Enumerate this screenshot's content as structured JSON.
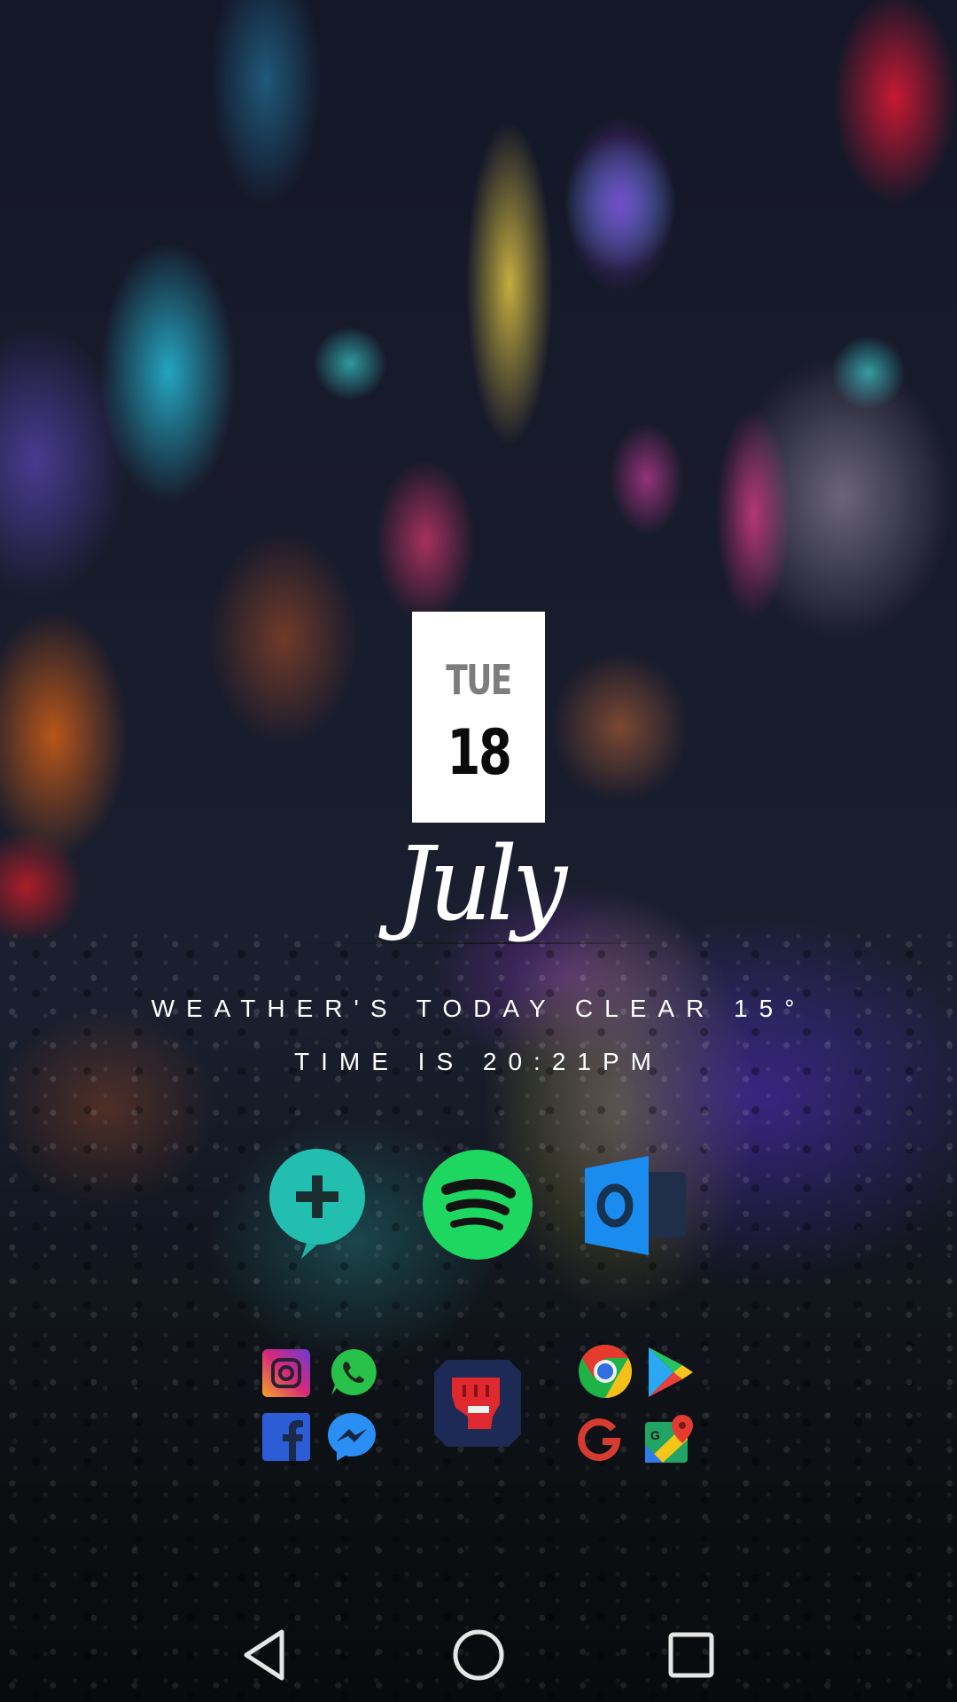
{
  "widget": {
    "day": "TUE",
    "date": "18",
    "month_script": "July",
    "weather": "WEATHER'S TODAY CLEAR 15°",
    "time": "TIME IS 20:21PM"
  },
  "dock_apps": [
    {
      "name": "Google Allo",
      "icon": "chat-plus-icon"
    },
    {
      "name": "Spotify",
      "icon": "spotify-icon"
    },
    {
      "name": "Outlook",
      "icon": "outlook-icon"
    }
  ],
  "folders": [
    {
      "icons": [
        "instagram-icon",
        "whatsapp-icon",
        "facebook-icon",
        "messenger-icon"
      ]
    },
    {
      "icons": [
        "pewdiepie-fist-icon"
      ]
    },
    {
      "icons": [
        "chrome-icon",
        "play-store-icon",
        "google-plus-icon",
        "maps-icon"
      ]
    }
  ],
  "navigation": {
    "back": "back-icon",
    "home": "home-icon",
    "recents": "recents-icon"
  }
}
